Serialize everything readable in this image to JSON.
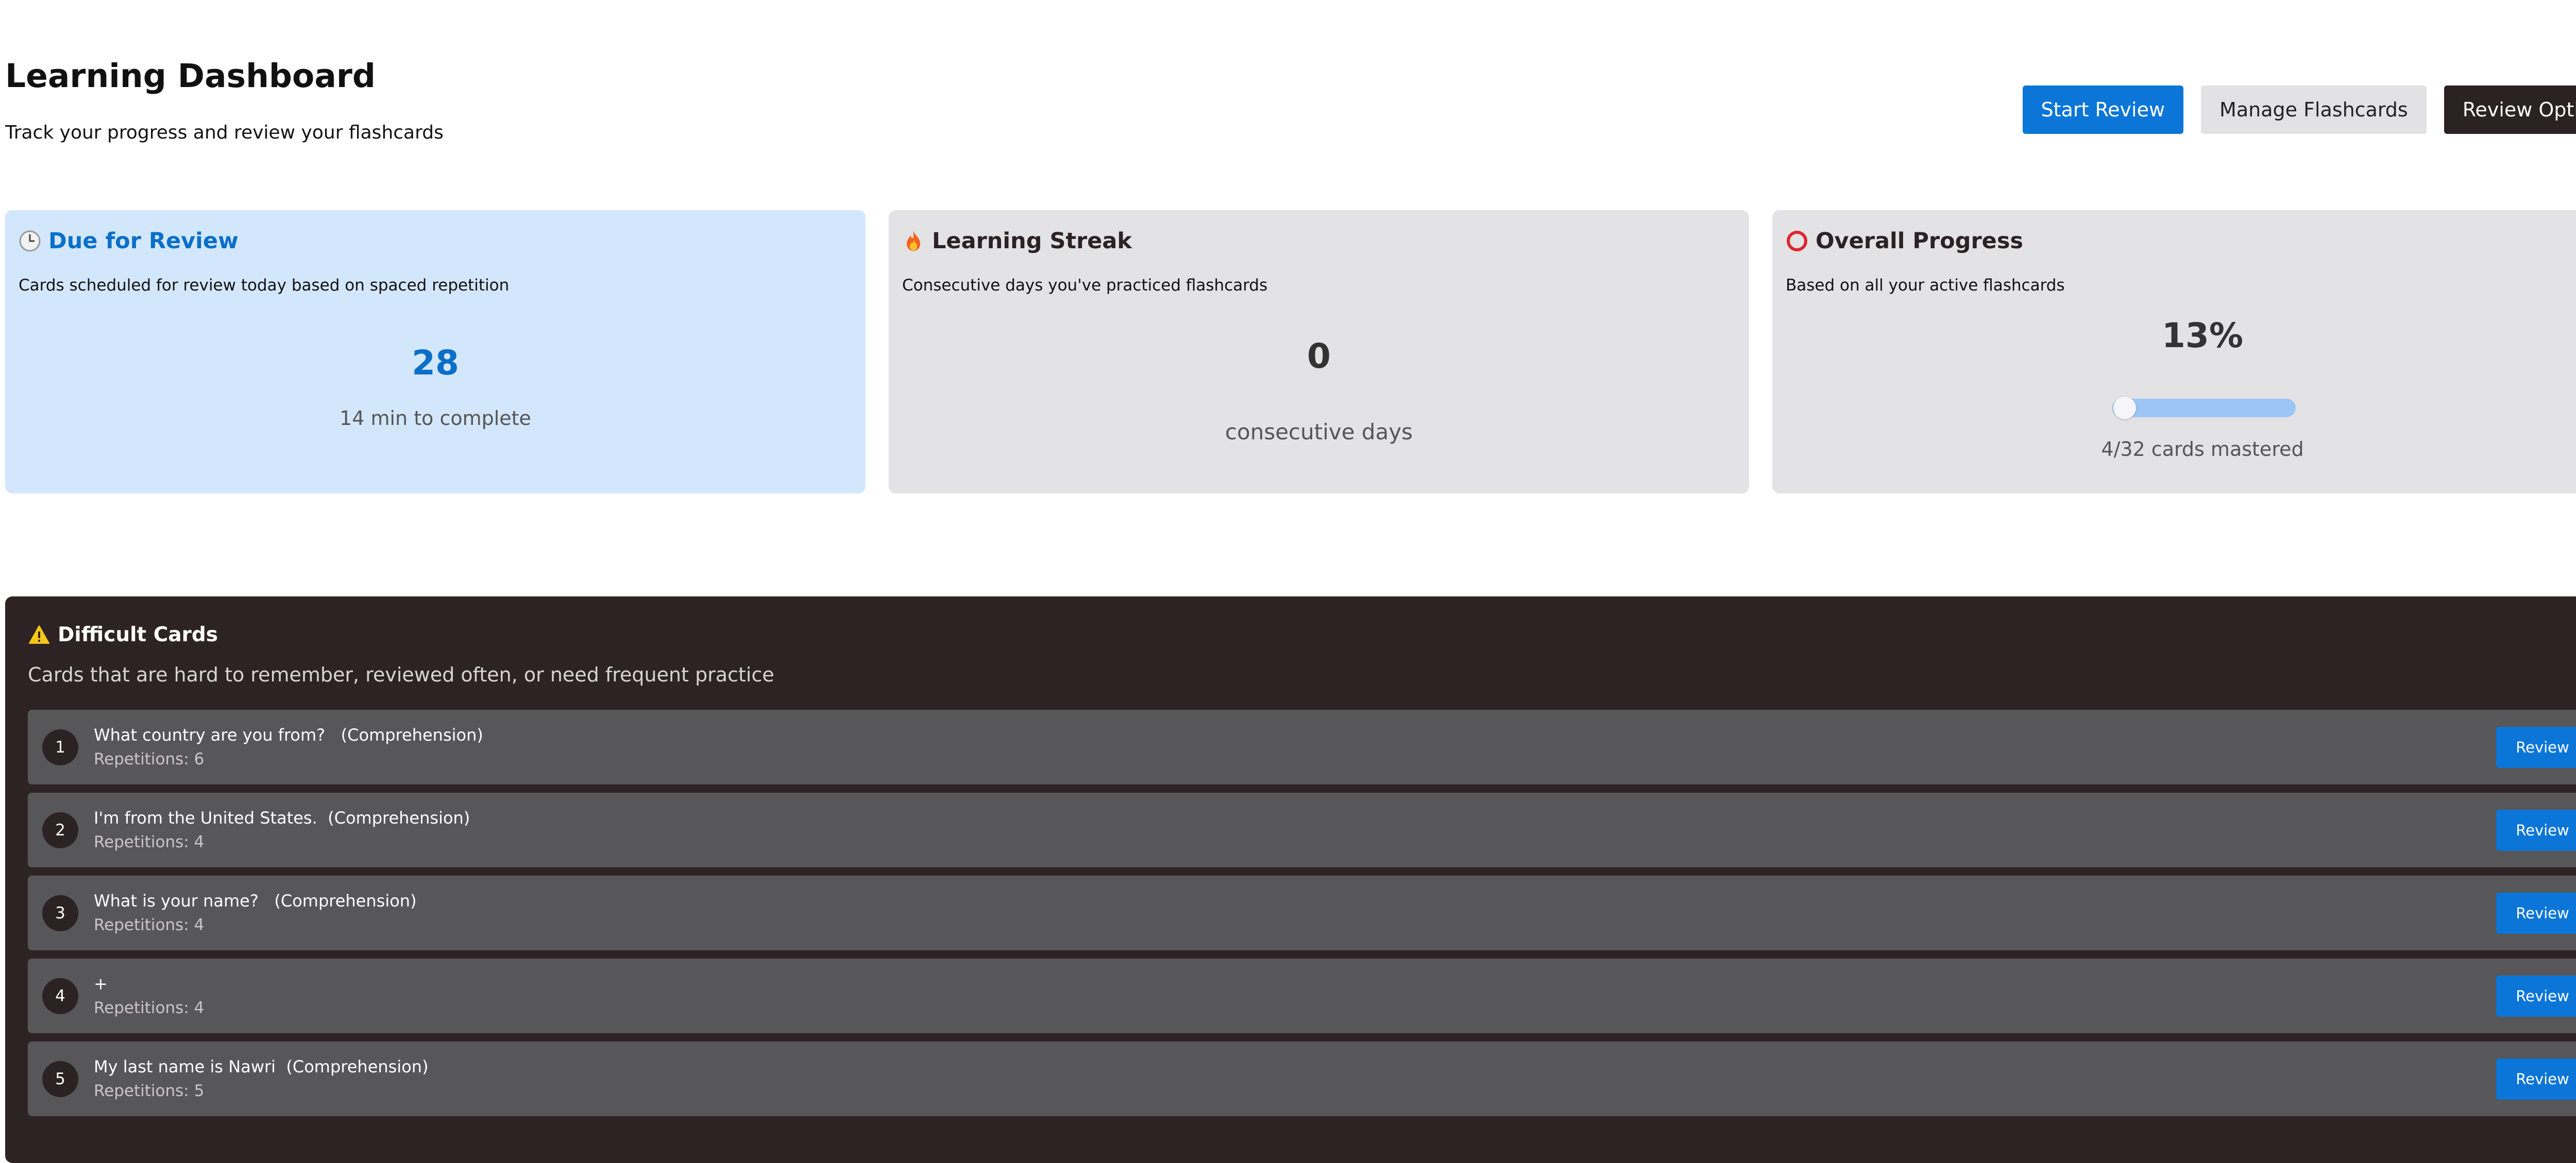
{
  "header": {
    "title": "Learning Dashboard",
    "subtitle": "Track your progress and review your flashcards",
    "start_review": "Start Review",
    "manage_flashcards": "Manage Flashcards",
    "review_options": "Review Options"
  },
  "stats": {
    "due": {
      "title": "Due for Review",
      "icon": "clock-icon",
      "description": "Cards scheduled for review today based on spaced repetition",
      "value": "28",
      "sub": "14 min to complete"
    },
    "streak": {
      "title": "Learning Streak",
      "icon": "fire-icon",
      "description": "Consecutive days you've practiced flashcards",
      "value": "0",
      "sub": "consecutive days"
    },
    "progress": {
      "title": "Overall Progress",
      "icon": "ring-icon",
      "description": "Based on all your active flashcards",
      "value": "13%",
      "fraction": 0.13,
      "sub": "4/32 cards mastered"
    }
  },
  "difficult": {
    "title": "Difficult Cards",
    "icon": "warning-icon",
    "description": "Cards that are hard to remember, reviewed often, or need frequent practice",
    "review_label": "Review",
    "cards": [
      {
        "num": "1",
        "question": "What country are you from?   (Comprehension)",
        "reps": "Repetitions: 6"
      },
      {
        "num": "2",
        "question": "I'm from the United States.  (Comprehension)",
        "reps": "Repetitions: 4"
      },
      {
        "num": "3",
        "question": "What is your name?   (Comprehension)",
        "reps": "Repetitions: 4"
      },
      {
        "num": "4",
        "question": "+",
        "reps": "Repetitions: 4"
      },
      {
        "num": "5",
        "question": "My last name is Nawri  (Comprehension)",
        "reps": "Repetitions: 5"
      }
    ]
  },
  "colors": {
    "accent": "#0b76d8",
    "due_card_bg": "#d3e7fc",
    "neutral_card_bg": "#e3e2e4",
    "dark_panel": "#2d2325",
    "row_bg": "#575658",
    "progress_bar": "#9cc6f6"
  }
}
